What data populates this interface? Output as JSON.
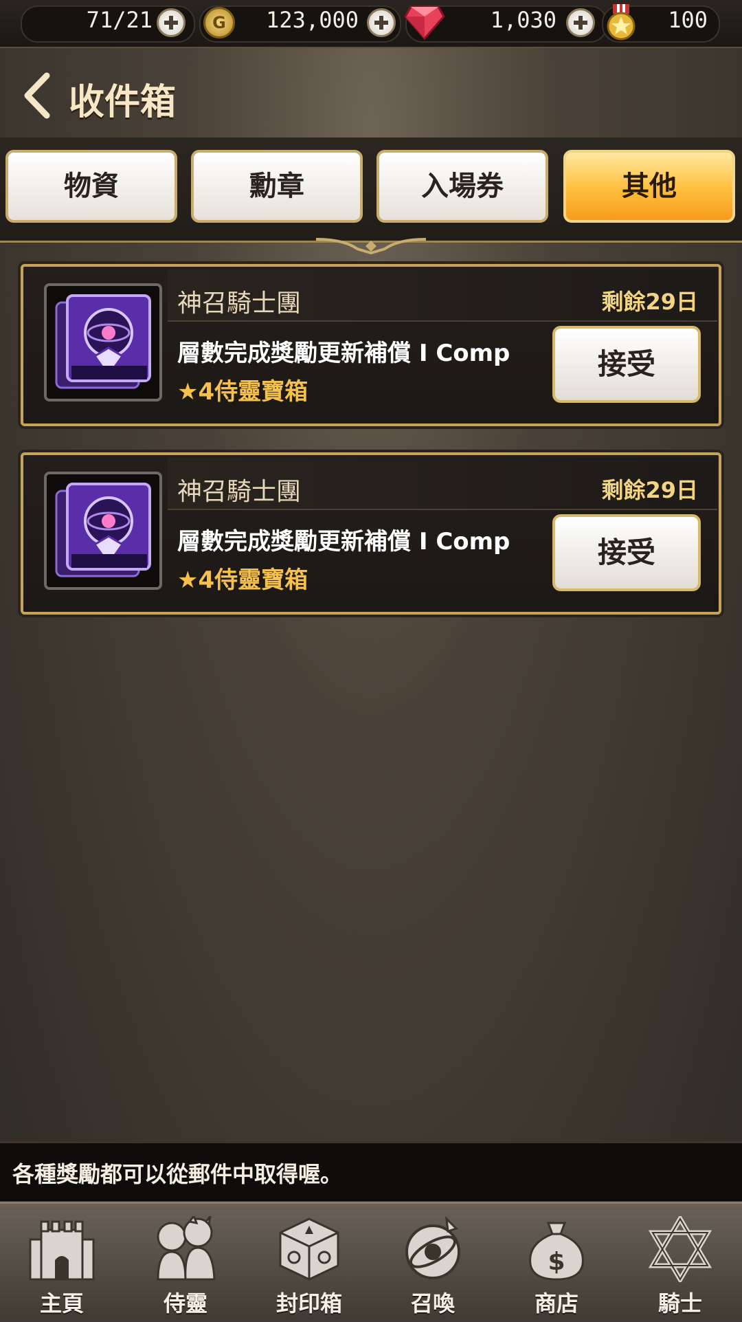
{
  "currencies": {
    "keys": "71/21",
    "gold": "123,000",
    "gold_glyph": "G",
    "gems": "1,030",
    "medals": "100"
  },
  "header": {
    "title": "收件箱"
  },
  "tabs": [
    {
      "label": "物資",
      "active": false
    },
    {
      "label": "勳章",
      "active": false
    },
    {
      "label": "入場券",
      "active": false
    },
    {
      "label": "其他",
      "active": true
    }
  ],
  "mails": [
    {
      "sender": "神召騎士團",
      "remaining": "剩餘29日",
      "message": "層數完成獎勵更新補償 I Comp",
      "item": "★4侍靈寶箱",
      "accept_label": "接受",
      "icon": "purple-chest-icon"
    },
    {
      "sender": "神召騎士團",
      "remaining": "剩餘29日",
      "message": "層數完成獎勵更新補償 I Comp",
      "item": "★4侍靈寶箱",
      "accept_label": "接受",
      "icon": "purple-chest-icon"
    }
  ],
  "hint": "各種獎勵都可以從郵件中取得喔。",
  "nav": [
    {
      "label": "主頁",
      "icon": "castle-icon"
    },
    {
      "label": "侍靈",
      "icon": "companions-icon"
    },
    {
      "label": "封印箱",
      "icon": "seal-box-icon"
    },
    {
      "label": "召喚",
      "icon": "summon-icon"
    },
    {
      "label": "商店",
      "icon": "shop-bag-icon"
    },
    {
      "label": "騎士",
      "icon": "hexagram-icon"
    }
  ],
  "colors": {
    "accent_gold": "#c5a35c",
    "active_tab": "#ffbe3c",
    "item_text": "#f5c04c",
    "remaining_text": "#f2d483"
  }
}
